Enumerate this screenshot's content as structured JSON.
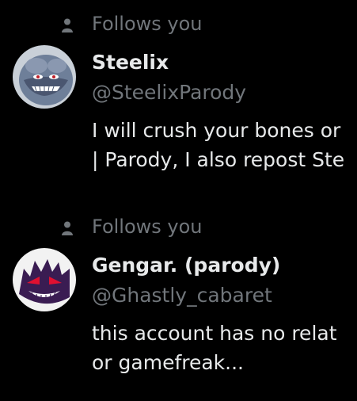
{
  "followers": [
    {
      "follows_label": "Follows you",
      "display_name": "Steelix",
      "handle": "@SteelixParody",
      "bio_lines": [
        "I will crush your bones or",
        "| Parody, I also repost Ste"
      ],
      "avatar_bg": "#6e7f99"
    },
    {
      "follows_label": "Follows you",
      "display_name": "Gengar. (parody)",
      "handle": "@Ghastly_cabaret",
      "bio_lines": [
        "this account has no relat",
        "or gamefreak..."
      ],
      "avatar_bg": "#f2f2f2"
    }
  ],
  "colors": {
    "background": "#000000",
    "primary_text": "#e7e9ea",
    "secondary_text": "#71767b"
  },
  "icons": {
    "follows": "person-icon"
  }
}
